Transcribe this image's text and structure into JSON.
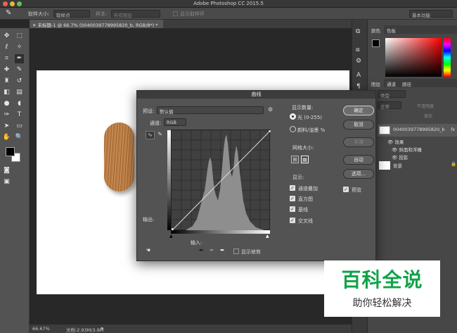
{
  "window": {
    "title": "Adobe Photoshop CC 2015.5"
  },
  "options": {
    "sample_size_label": "取样大小:",
    "sample_size_value": "取样点",
    "sample_label": "样本:",
    "sample_value": "所有图层",
    "show_ring": "显示取样环",
    "workspace": "基本功能"
  },
  "document": {
    "tab": "未标题-1 @ 66.7% (0040039778995820_b, RGB/8*) *",
    "zoom": "66.67%",
    "docsize": "文档:2.93M/3.9M"
  },
  "panels": {
    "color_tabs": [
      "颜色",
      "色板"
    ],
    "layer_tabs": [
      "图层",
      "通道",
      "路径"
    ],
    "kind_label": "类型",
    "normal": "正常",
    "opacity": "不透明度",
    "fill": "填充",
    "layers": [
      {
        "name": "0040039778995820_b",
        "fx": "fx"
      },
      {
        "name": "效果"
      },
      {
        "name": "斜面和浮雕"
      },
      {
        "name": "投影"
      },
      {
        "name": "背景"
      }
    ]
  },
  "curves": {
    "title": "曲线",
    "preset_label": "预设:",
    "preset_value": "默认值",
    "channel_label": "通道:",
    "channel_value": "RGB",
    "output_label": "输出:",
    "input_label": "输入:",
    "show_clipping": "显示修剪",
    "show_amount_label": "显示数量:",
    "light_option": "光 (0-255)",
    "pigment_option": "颜料/油墨 %",
    "grid_size_label": "网格大小:",
    "show_label": "显示:",
    "show_options": [
      "通道叠加",
      "直方图",
      "基线",
      "交叉线"
    ],
    "buttons": {
      "ok": "确定",
      "cancel": "取消",
      "smooth": "平滑",
      "auto": "自动",
      "options": "选项..."
    },
    "preview_label": "预览"
  },
  "watermark": {
    "title": "百科全说",
    "subtitle": "助你轻松解决",
    "color": "#12a24a"
  }
}
